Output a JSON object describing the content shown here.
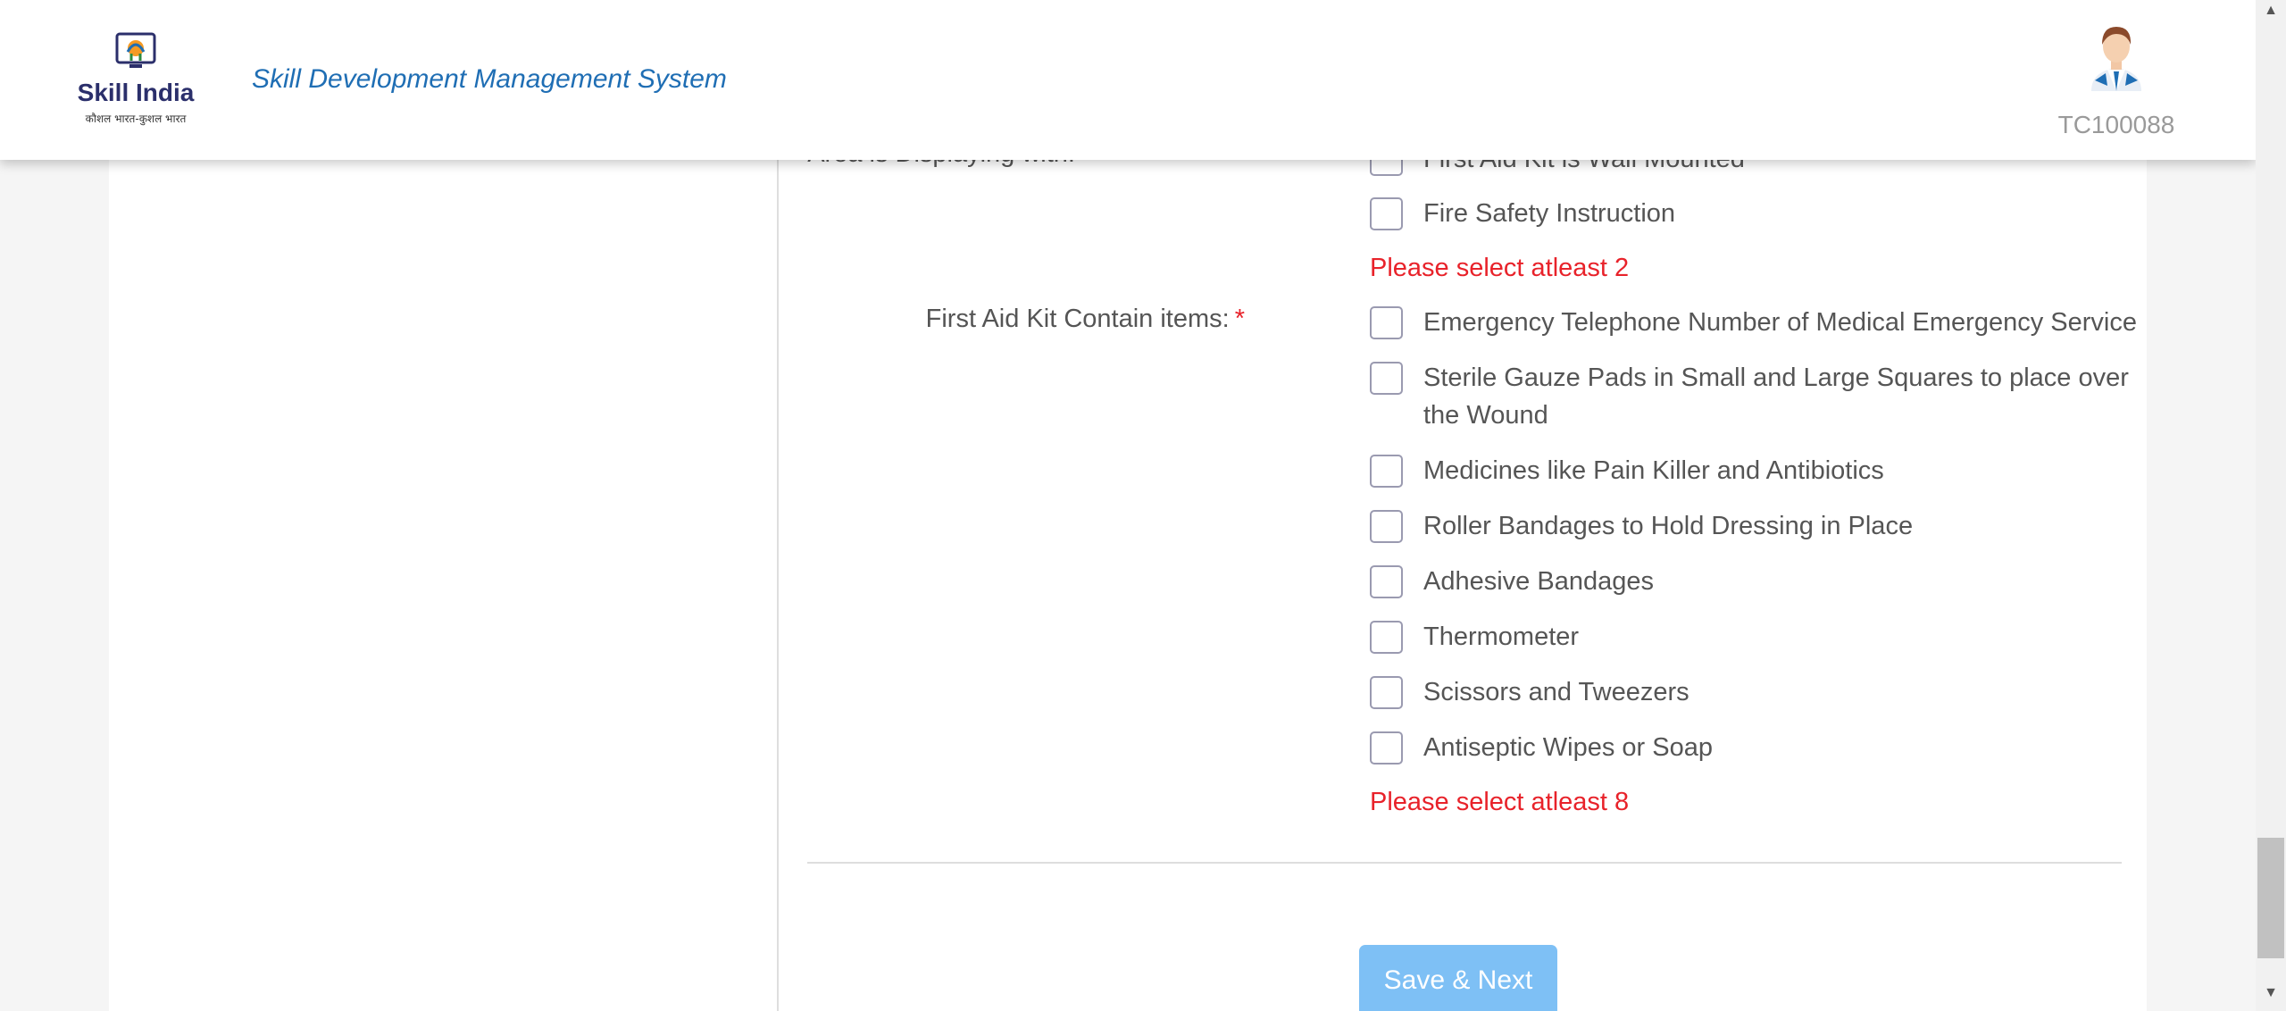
{
  "header": {
    "logo_title": "Skill India",
    "logo_subtitle": "कौशल भारत-कुशल भारत",
    "app_title": "Skill Development Management System",
    "user_id": "TC100088"
  },
  "form": {
    "partial_label": "Area is Displaying with:",
    "partial_option": "First Aid Kit is Wall Mounted",
    "fire_option": "Fire Safety Instruction",
    "error_1": "Please select atleast 2",
    "first_aid_label": "First Aid Kit Contain items:",
    "required_mark": "*",
    "first_aid_options": [
      "Emergency Telephone Number of Medical Emergency Service",
      "Sterile Gauze Pads in Small and Large Squares to place over the Wound",
      "Medicines like Pain Killer and Antibiotics",
      "Roller Bandages to Hold Dressing in Place",
      "Adhesive Bandages",
      "Thermometer",
      "Scissors and Tweezers",
      "Antiseptic Wipes or Soap"
    ],
    "error_2": "Please select atleast 8",
    "save_button": "Save & Next"
  },
  "scrollbar": {
    "up_icon": "▲",
    "down_icon": "▼"
  },
  "colors": {
    "accent": "#1f6eb4",
    "error": "#e8222a",
    "button": "#7ec0f5"
  }
}
